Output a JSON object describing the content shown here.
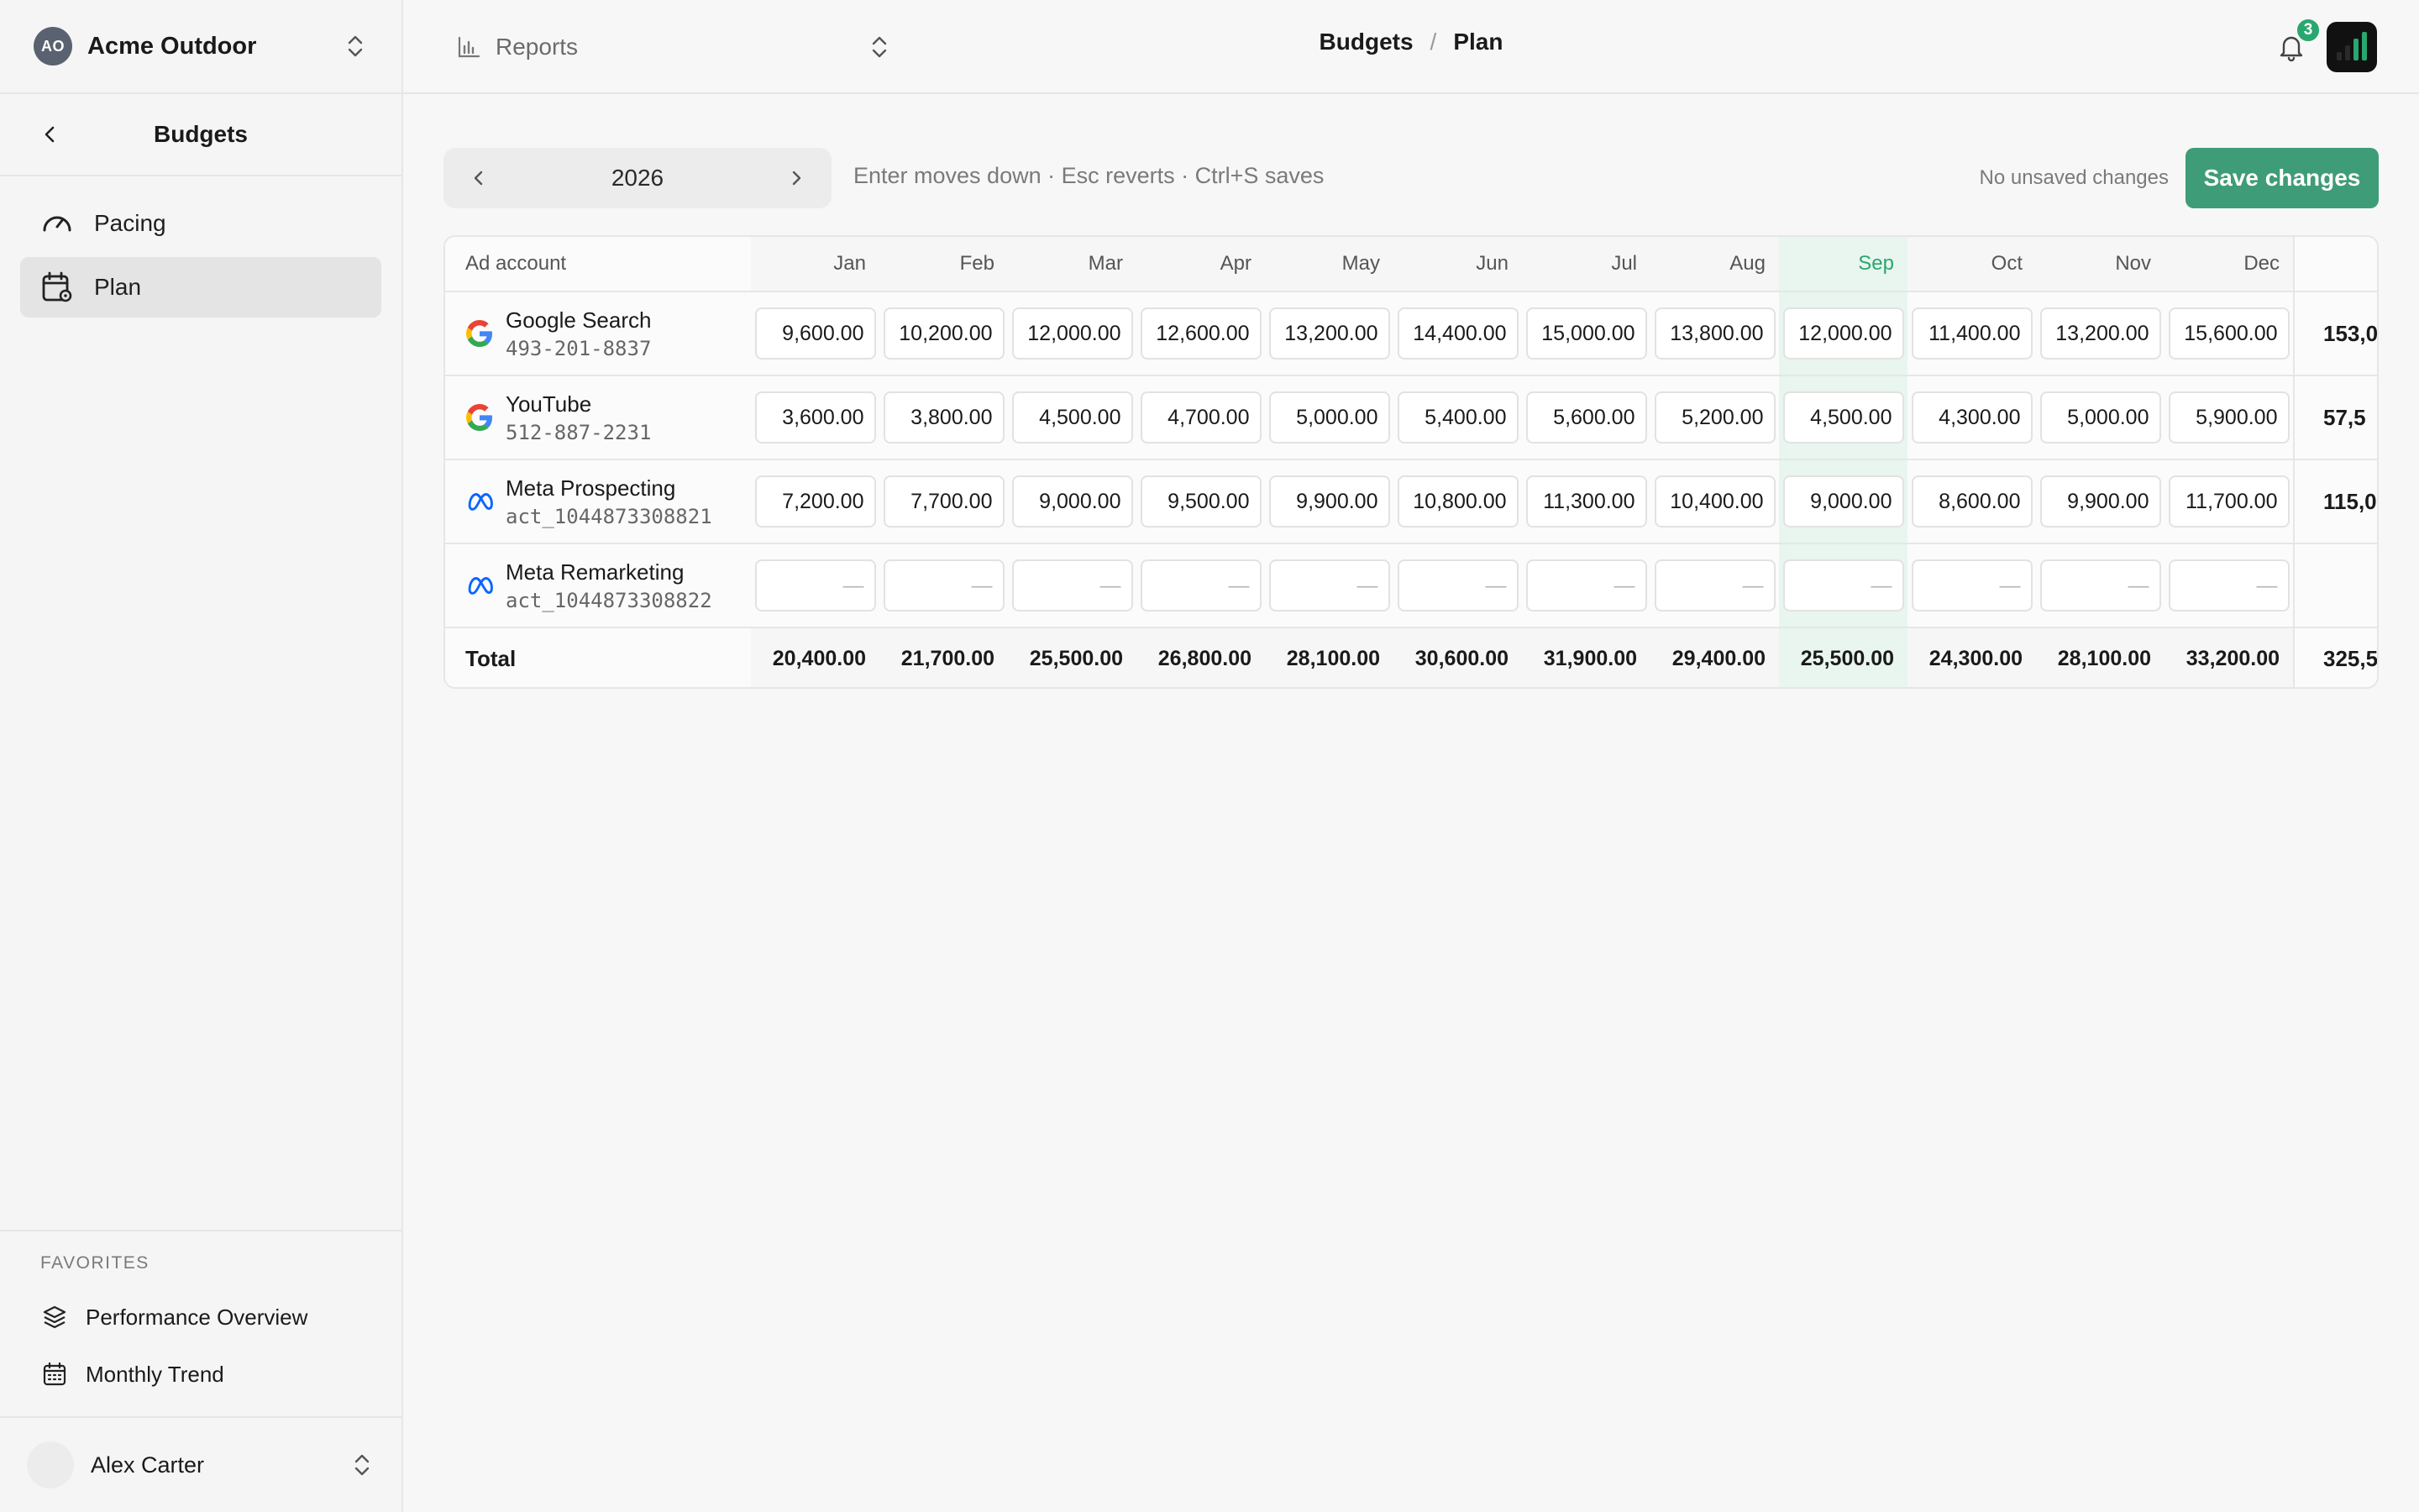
{
  "org": {
    "initials": "AO",
    "name": "Acme Outdoor"
  },
  "sidebar": {
    "section_title": "Budgets",
    "items": [
      {
        "label": "Pacing",
        "icon": "gauge-icon",
        "active": false
      },
      {
        "label": "Plan",
        "icon": "calendar-settings-icon",
        "active": true
      }
    ],
    "favorites_label": "FAVORITES",
    "favorites": [
      {
        "label": "Performance Overview",
        "icon": "layers-icon"
      },
      {
        "label": "Monthly Trend",
        "icon": "calendar-icon"
      }
    ],
    "user": {
      "name": "Alex Carter"
    }
  },
  "topbar": {
    "reports_label": "Reports",
    "breadcrumb": [
      "Budgets",
      "Plan"
    ],
    "breadcrumb_separator": "/",
    "notification_count": "3"
  },
  "toolbar": {
    "year": "2026",
    "hint": "Enter moves down · Esc reverts · Ctrl+S saves",
    "unsaved_status": "No unsaved changes",
    "save_label": "Save changes"
  },
  "table": {
    "account_header": "Ad account",
    "months": [
      "Jan",
      "Feb",
      "Mar",
      "Apr",
      "May",
      "Jun",
      "Jul",
      "Aug",
      "Sep",
      "Oct",
      "Nov",
      "Dec"
    ],
    "highlight_month": "Sep",
    "empty_placeholder": "—",
    "rows": [
      {
        "name": "Google Search",
        "account_id": "493-201-8837",
        "platform": "google",
        "values": [
          "9,600.00",
          "10,200.00",
          "12,000.00",
          "12,600.00",
          "13,200.00",
          "14,400.00",
          "15,000.00",
          "13,800.00",
          "12,000.00",
          "11,400.00",
          "13,200.00",
          "15,600.00"
        ],
        "total": "153,0"
      },
      {
        "name": "YouTube",
        "account_id": "512-887-2231",
        "platform": "google",
        "values": [
          "3,600.00",
          "3,800.00",
          "4,500.00",
          "4,700.00",
          "5,000.00",
          "5,400.00",
          "5,600.00",
          "5,200.00",
          "4,500.00",
          "4,300.00",
          "5,000.00",
          "5,900.00"
        ],
        "total": "57,5"
      },
      {
        "name": "Meta Prospecting",
        "account_id": "act_1044873308821",
        "platform": "meta",
        "values": [
          "7,200.00",
          "7,700.00",
          "9,000.00",
          "9,500.00",
          "9,900.00",
          "10,800.00",
          "11,300.00",
          "10,400.00",
          "9,000.00",
          "8,600.00",
          "9,900.00",
          "11,700.00"
        ],
        "total": "115,0"
      },
      {
        "name": "Meta Remarketing",
        "account_id": "act_1044873308822",
        "platform": "meta",
        "values": [
          "",
          "",
          "",
          "",
          "",
          "",
          "",
          "",
          "",
          "",
          "",
          ""
        ],
        "total": ""
      }
    ],
    "total_label": "Total",
    "totals": [
      "20,400.00",
      "21,700.00",
      "25,500.00",
      "26,800.00",
      "28,100.00",
      "30,600.00",
      "31,900.00",
      "29,400.00",
      "25,500.00",
      "24,300.00",
      "28,100.00",
      "33,200.00"
    ],
    "grand_total": "325,5"
  },
  "colors": {
    "accent": "#2aa76f",
    "save_button": "#3f9c78",
    "highlight_column": "#e9f5ef"
  }
}
